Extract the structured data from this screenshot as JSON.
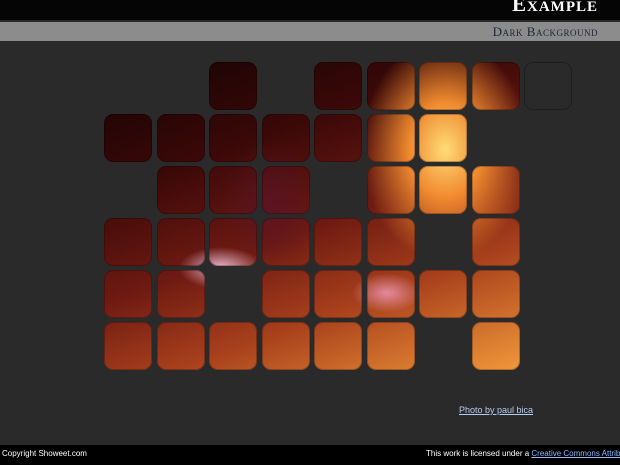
{
  "header": {
    "title": "Example",
    "subtitle": "Dark Background"
  },
  "photo_credit": "Photo by paul bica",
  "footer": {
    "copyright": "Copyright Showeet.com",
    "license_text": "This work is licensed under a ",
    "license_link": "Creative Commons Attributio"
  },
  "mosaic": {
    "rows": [
      [
        0,
        0,
        1,
        0,
        1,
        1,
        1,
        1,
        1
      ],
      [
        1,
        1,
        1,
        1,
        1,
        1,
        1,
        0,
        0
      ],
      [
        0,
        1,
        1,
        1,
        0,
        1,
        1,
        1,
        0
      ],
      [
        1,
        1,
        1,
        1,
        1,
        1,
        0,
        1,
        0
      ],
      [
        1,
        1,
        0,
        1,
        1,
        1,
        1,
        1,
        0
      ],
      [
        1,
        1,
        1,
        1,
        1,
        1,
        0,
        1,
        0
      ]
    ]
  }
}
